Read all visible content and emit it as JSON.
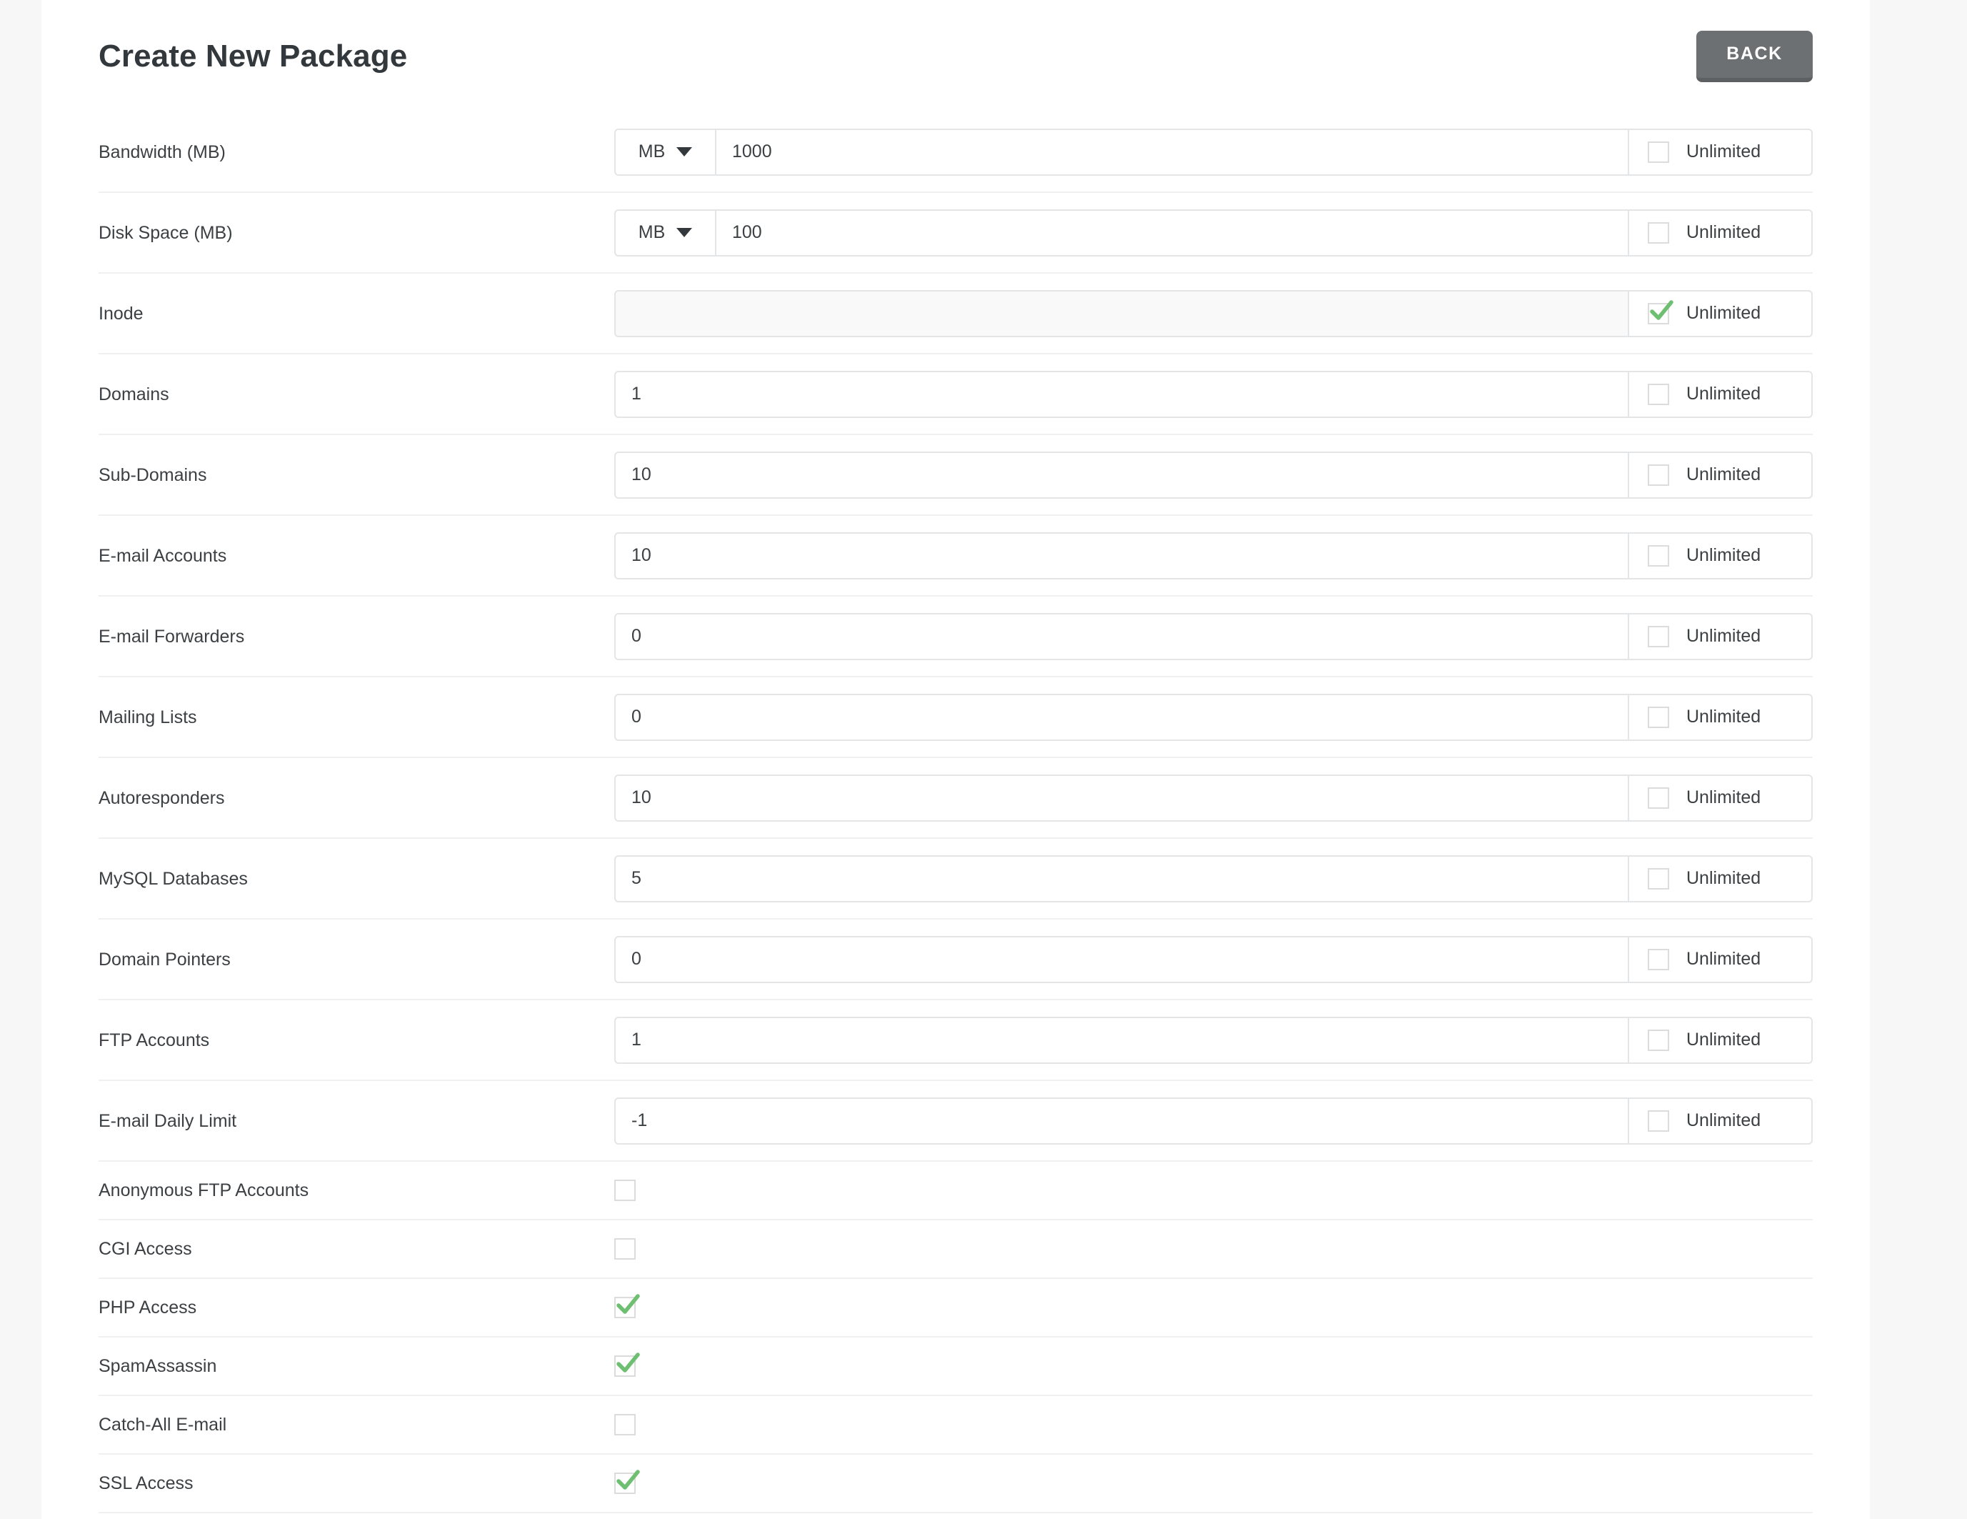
{
  "header": {
    "title": "Create New Package",
    "back_label": "BACK"
  },
  "labels": {
    "unlimited": "Unlimited"
  },
  "colors": {
    "accent_green": "#6fbf73",
    "button_gray": "#6d7072",
    "text": "#3c4043",
    "border": "#e3e5e6",
    "divider": "#f0f0f0"
  },
  "icons": {
    "caret": "chevron-down-icon",
    "check": "check-icon"
  },
  "limit_rows": [
    {
      "label": "Bandwidth (MB)",
      "unit": "MB",
      "value": "1000",
      "disabled": false,
      "unlimited": false
    },
    {
      "label": "Disk Space (MB)",
      "unit": "MB",
      "value": "100",
      "disabled": false,
      "unlimited": false
    },
    {
      "label": "Inode",
      "unit": null,
      "value": "",
      "disabled": true,
      "unlimited": true
    },
    {
      "label": "Domains",
      "unit": null,
      "value": "1",
      "disabled": false,
      "unlimited": false
    },
    {
      "label": "Sub-Domains",
      "unit": null,
      "value": "10",
      "disabled": false,
      "unlimited": false
    },
    {
      "label": "E-mail Accounts",
      "unit": null,
      "value": "10",
      "disabled": false,
      "unlimited": false
    },
    {
      "label": "E-mail Forwarders",
      "unit": null,
      "value": "0",
      "disabled": false,
      "unlimited": false
    },
    {
      "label": "Mailing Lists",
      "unit": null,
      "value": "0",
      "disabled": false,
      "unlimited": false
    },
    {
      "label": "Autoresponders",
      "unit": null,
      "value": "10",
      "disabled": false,
      "unlimited": false
    },
    {
      "label": "MySQL Databases",
      "unit": null,
      "value": "5",
      "disabled": false,
      "unlimited": false
    },
    {
      "label": "Domain Pointers",
      "unit": null,
      "value": "0",
      "disabled": false,
      "unlimited": false
    },
    {
      "label": "FTP Accounts",
      "unit": null,
      "value": "1",
      "disabled": false,
      "unlimited": false
    },
    {
      "label": "E-mail Daily Limit",
      "unit": null,
      "value": "-1",
      "disabled": false,
      "unlimited": false
    }
  ],
  "toggle_rows": [
    {
      "label": "Anonymous FTP Accounts",
      "checked": false
    },
    {
      "label": "CGI Access",
      "checked": false
    },
    {
      "label": "PHP Access",
      "checked": true
    },
    {
      "label": "SpamAssassin",
      "checked": true
    },
    {
      "label": "Catch-All E-mail",
      "checked": false
    },
    {
      "label": "SSL Access",
      "checked": true
    }
  ]
}
